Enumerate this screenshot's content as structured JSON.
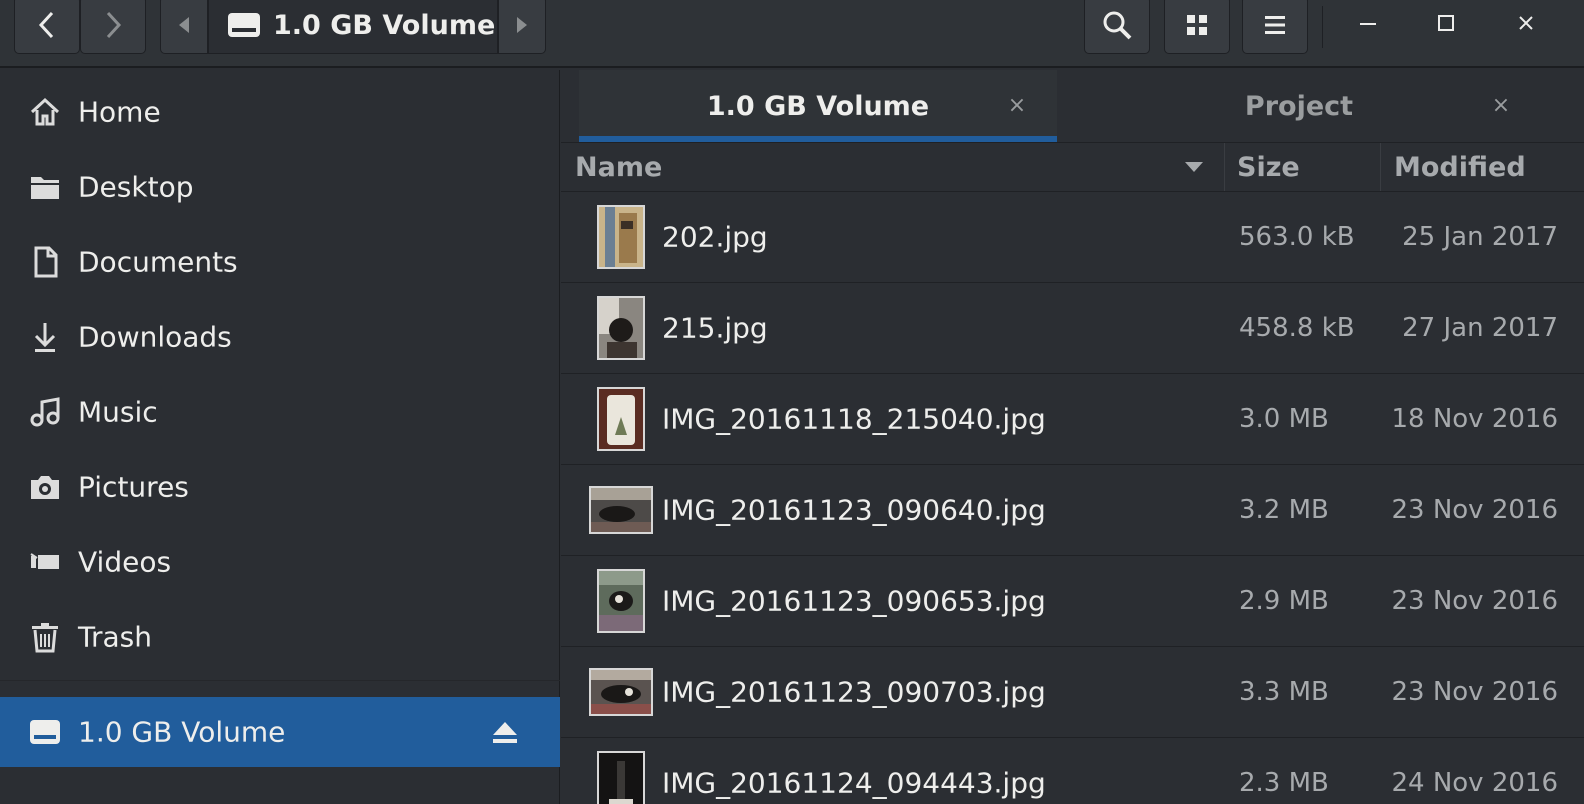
{
  "header": {
    "back_icon": "chevron-left-icon",
    "forward_icon": "chevron-right-icon",
    "path_prev_icon": "triangle-left-icon",
    "path_next_icon": "triangle-right-icon",
    "path_label": "1.0 GB Volume",
    "drive_icon": "drive-icon",
    "search_icon": "search-icon",
    "view_icon": "grid-icon",
    "menu_icon": "hamburger-menu-icon",
    "minimize_icon": "minimize-icon",
    "maximize_icon": "maximize-icon",
    "close_icon": "close-icon"
  },
  "sidebar": {
    "items": [
      {
        "label": "Home",
        "icon": "home-icon"
      },
      {
        "label": "Desktop",
        "icon": "folder-icon"
      },
      {
        "label": "Documents",
        "icon": "document-icon"
      },
      {
        "label": "Downloads",
        "icon": "download-icon"
      },
      {
        "label": "Music",
        "icon": "music-icon"
      },
      {
        "label": "Pictures",
        "icon": "camera-icon"
      },
      {
        "label": "Videos",
        "icon": "video-icon"
      },
      {
        "label": "Trash",
        "icon": "trash-icon"
      }
    ],
    "volume": {
      "label": "1.0 GB Volume",
      "icon": "drive-icon",
      "eject_icon": "eject-icon"
    }
  },
  "tabs": [
    {
      "label": "1.0 GB Volume",
      "close": "×",
      "active": true
    },
    {
      "label": "Project",
      "close": "×",
      "active": false
    }
  ],
  "columns": {
    "name": "Name",
    "size": "Size",
    "modified": "Modified"
  },
  "files": [
    {
      "name": "202.jpg",
      "size": "563.0 kB",
      "modified": "25 Jan 2017"
    },
    {
      "name": "215.jpg",
      "size": "458.8 kB",
      "modified": "27 Jan 2017"
    },
    {
      "name": "IMG_20161118_215040.jpg",
      "size": "3.0 MB",
      "modified": "18 Nov 2016"
    },
    {
      "name": "IMG_20161123_090640.jpg",
      "size": "3.2 MB",
      "modified": "23 Nov 2016"
    },
    {
      "name": "IMG_20161123_090653.jpg",
      "size": "2.9 MB",
      "modified": "23 Nov 2016"
    },
    {
      "name": "IMG_20161123_090703.jpg",
      "size": "3.3 MB",
      "modified": "23 Nov 2016"
    },
    {
      "name": "IMG_20161124_094443.jpg",
      "size": "2.3 MB",
      "modified": "24 Nov 2016"
    }
  ],
  "colors": {
    "accent": "#215d9c",
    "background": "#2b2e33",
    "headerbar": "#2f3337",
    "text": "#eeeeec",
    "secondary_text": "#a7aaad"
  }
}
